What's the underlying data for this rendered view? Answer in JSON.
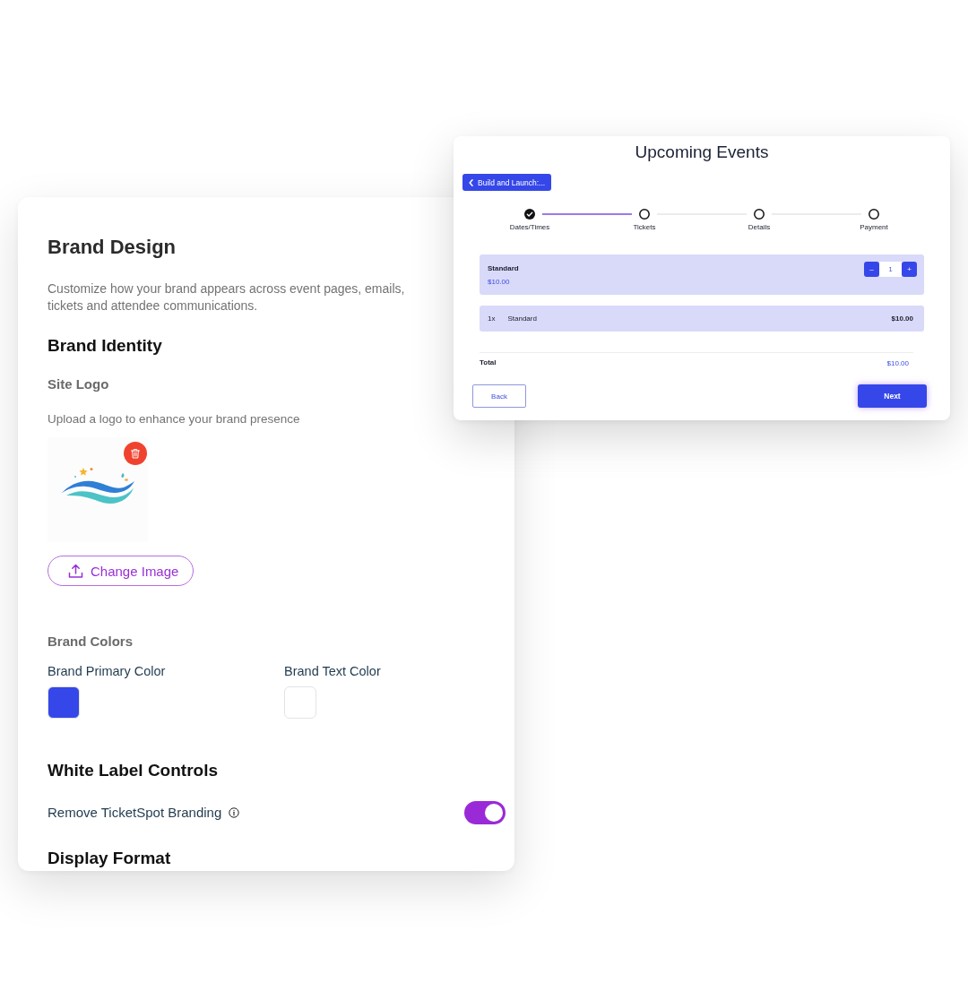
{
  "brand_design": {
    "title": "Brand Design",
    "description": "Customize how your brand appears across event pages, emails, tickets and attendee communications.",
    "brand_identity": {
      "heading": "Brand Identity",
      "site_logo": {
        "label": "Site Logo",
        "hint": "Upload a logo to enhance your brand presence",
        "change_button": "Change Image"
      }
    },
    "brand_colors": {
      "label": "Brand Colors",
      "colors": [
        {
          "label": "Brand Primary Color",
          "color": "#3547e8"
        },
        {
          "label": "Brand Text Color",
          "color": "#ffffff"
        }
      ]
    },
    "white_label": {
      "heading": "White Label Controls",
      "settings": [
        {
          "label": "Remove TicketSpot Branding",
          "on": true
        }
      ]
    },
    "display_format": {
      "heading": "Display Format"
    }
  },
  "event_preview": {
    "title": "Upcoming Events",
    "back_link": "Build and Launch:...",
    "steps": [
      {
        "label": "Dates/Times",
        "completed": true
      },
      {
        "label": "Tickets",
        "completed": false
      },
      {
        "label": "Details",
        "completed": false
      },
      {
        "label": "Payment",
        "completed": false
      }
    ],
    "tickets": [
      {
        "name": "Standard",
        "price": "$10.00",
        "decrement": "–",
        "quantity": "1",
        "increment": "+"
      }
    ],
    "order_items": [
      {
        "quantity": "1x",
        "name": "Standard",
        "amount": "$10.00"
      }
    ],
    "total": {
      "label": "Total",
      "amount": "$10.00"
    },
    "actions": {
      "back": "Back",
      "next": "Next"
    }
  }
}
